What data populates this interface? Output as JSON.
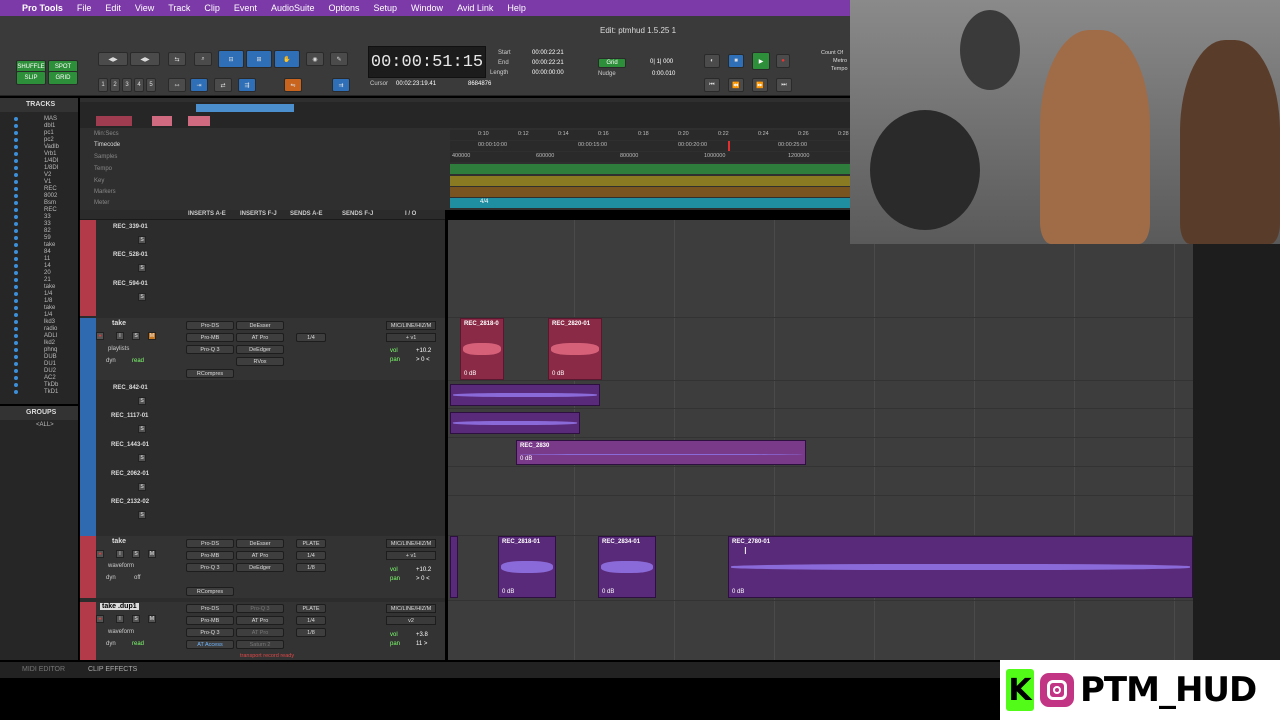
{
  "menubar": {
    "apple_icon": "apple-icon",
    "items": [
      "Pro Tools",
      "File",
      "Edit",
      "View",
      "Track",
      "Clip",
      "Event",
      "AudioSuite",
      "Options",
      "Setup",
      "Window",
      "Avid Link",
      "Help"
    ]
  },
  "window_title": "Edit: ptmhud 1.5.25 1",
  "toolbar": {
    "shuffle": "SHUFFLE",
    "spot": "SPOT",
    "slip": "SLIP",
    "grid": "GRID",
    "counter": "00:00:51:15",
    "start_label": "Start",
    "end_label": "End",
    "length_label": "Length",
    "start": "00:00:22:21",
    "end": "00:00:22:21",
    "length": "00:00:00:00",
    "cursor_label": "Cursor",
    "cursor": "00:02:23:19.41",
    "sample": "8684876",
    "grid_label": "Grid",
    "grid_value": "0| 1| 000",
    "nudge_label": "Nudge",
    "nudge_value": "0:00.010",
    "count_off": "Count Of",
    "metro": "Metro",
    "tempo": "Tempo",
    "track_heights": [
      "1",
      "2",
      "3",
      "4",
      "5"
    ]
  },
  "tracks_panel": {
    "title": "TRACKS",
    "items": [
      "MAS",
      "dbl1",
      "pc1",
      "pc2",
      "Vadlb",
      "Vrb1",
      "1/4DI",
      "1/8DI",
      "V2",
      "V1",
      "REC",
      "8002",
      "Bsm",
      "REC",
      "33",
      "33",
      "82",
      "59",
      "take",
      "84",
      "11",
      "14",
      "20",
      "21",
      "take",
      "1/4",
      "1/8",
      "take",
      "1/4",
      "lkd3",
      "radio",
      "ADLI",
      "lkd2",
      "phnq",
      "DUB",
      "DU1",
      "DU2",
      "AC2",
      "TkDb",
      "TkD1"
    ],
    "groups_title": "GROUPS",
    "groups_all": "<ALL>"
  },
  "rulers": {
    "rows": [
      "Min:Secs",
      "Timecode",
      "Samples",
      "Tempo",
      "Key",
      "Markers",
      "Meter"
    ],
    "minsecs_ticks": [
      "0:10",
      "0:12",
      "0:14",
      "0:16",
      "0:18",
      "0:20",
      "0:22",
      "0:24",
      "0:26",
      "0:28"
    ],
    "timecode_ticks": [
      "00:00:10:00",
      "00:00:15:00",
      "00:00:20:00",
      "00:00:25:00"
    ],
    "samples_ticks": [
      "400000",
      "600000",
      "800000",
      "1000000",
      "1200000"
    ],
    "meter_value": "4/4"
  },
  "mix_header": {
    "inserts_ae": "INSERTS A-E",
    "inserts_fj": "INSERTS F-J",
    "sends_ae": "SENDS A-E",
    "sends_fj": "SENDS F-J",
    "io": "I / O"
  },
  "tracks": {
    "top_playlists": [
      "REC_339-01",
      "REC_528-01",
      "REC_594-01"
    ],
    "take1": {
      "name": "take",
      "playlists_label": "playlists",
      "dyn": "dyn",
      "read": "read",
      "inserts": [
        "Pro-DS",
        "Pro-MB",
        "Pro-Q 3",
        "",
        "RCompres"
      ],
      "inserts2": [
        "DeEsser",
        "AT Pro",
        "DeEdger",
        "RVox",
        ""
      ],
      "send_letters": [
        "a",
        "b",
        "c",
        "d",
        "e"
      ],
      "send_value": "1/4",
      "io_in": "MIC/LINE/HIZ/M",
      "io_out": "+ v1",
      "vol_label": "vol",
      "vol": "+10.2",
      "pan_label": "pan",
      "pan": "> 0 <"
    },
    "mid_playlists": [
      "REC_842-01",
      "REC_1117-01",
      "REC_1443-01",
      "REC_2062-01",
      "REC_2132-02"
    ],
    "take2": {
      "name": "take",
      "waveform": "waveform",
      "dyn": "dyn",
      "off": "off",
      "inserts": [
        "Pro-DS",
        "Pro-MB",
        "Pro-Q 3",
        "",
        "RCompres"
      ],
      "inserts2": [
        "DeEsser",
        "AT Pro",
        "DeEdger",
        "",
        ""
      ],
      "sends": [
        "PLATE",
        "1/4",
        "1/8",
        "",
        ""
      ],
      "io_in": "MIC/LINE/HIZ/M",
      "io_out": "+ v1",
      "vol": "+10.2",
      "pan": "> 0 <"
    },
    "take3": {
      "name": "take .dup1",
      "waveform": "waveform",
      "dyn": "dyn",
      "read": "read",
      "inserts": [
        "Pro-DS",
        "Pro-MB",
        "Pro-Q 3",
        "AT Access"
      ],
      "inserts2": [
        "Pro-Q 3",
        "AT Pro",
        "AT Pro",
        "Saturn 2"
      ],
      "sends": [
        "PLATE",
        "1/4",
        "1/8"
      ],
      "io_in": "MIC/LINE/HIZ/M",
      "io_out": "v2",
      "vol": "+3.8",
      "pan": "11 >",
      "status": "transport record ready"
    }
  },
  "clips": {
    "c1": {
      "label": "REC_2818-0",
      "db": "0 dB"
    },
    "c2": {
      "label": "REC_2820-01",
      "db": "0 dB"
    },
    "c3": {
      "label": "REC_2830",
      "db": "0 dB"
    },
    "c4": {
      "label": "REC_2818-01",
      "db": "0 dB"
    },
    "c5": {
      "label": "REC_2834-01",
      "db": "0 dB"
    },
    "c6": {
      "label": "REC_2780-01",
      "db": "0 dB"
    }
  },
  "bottom": {
    "midi_editor": "MIDI EDITOR",
    "clip_effects": "CLIP EFFECTS"
  },
  "brand": {
    "kick_letter": "K",
    "handle": "PTM_HUD"
  },
  "colors": {
    "menubar": "#7c3aa8",
    "clip_red": "#8a2a47",
    "clip_purple": "#5a2a7a",
    "kick_green": "#53fc18"
  }
}
